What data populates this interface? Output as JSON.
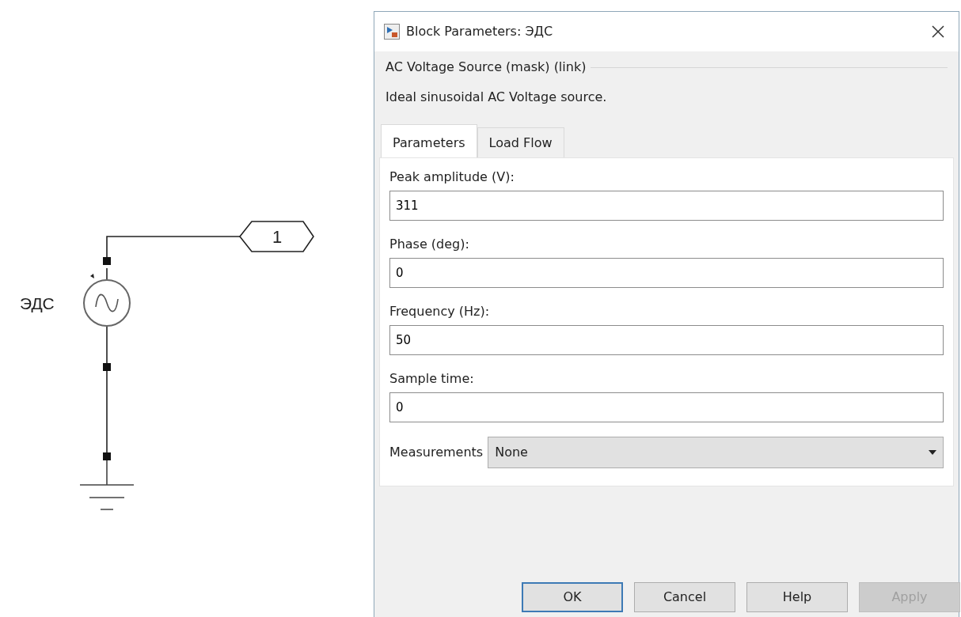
{
  "diagram": {
    "source_label": "ЭДС",
    "goto_tag": "1"
  },
  "dialog": {
    "title": "Block Parameters: ЭДС",
    "mask_header": "AC Voltage Source (mask) (link)",
    "description": "Ideal sinusoidal AC Voltage source.",
    "tabs": [
      {
        "label": "Parameters",
        "selected": true
      },
      {
        "label": "Load Flow",
        "selected": false
      }
    ],
    "fields": [
      {
        "label": "Peak amplitude (V):",
        "value": "311"
      },
      {
        "label": "Phase (deg):",
        "value": "0"
      },
      {
        "label": "Frequency (Hz):",
        "value": "50"
      },
      {
        "label": "Sample time:",
        "value": "0"
      }
    ],
    "measurements": {
      "label": "Measurements",
      "value": "None"
    },
    "buttons": [
      {
        "label": "OK",
        "default": true,
        "disabled": false
      },
      {
        "label": "Cancel",
        "default": false,
        "disabled": false
      },
      {
        "label": "Help",
        "default": false,
        "disabled": false
      },
      {
        "label": "Apply",
        "default": false,
        "disabled": true
      }
    ]
  }
}
